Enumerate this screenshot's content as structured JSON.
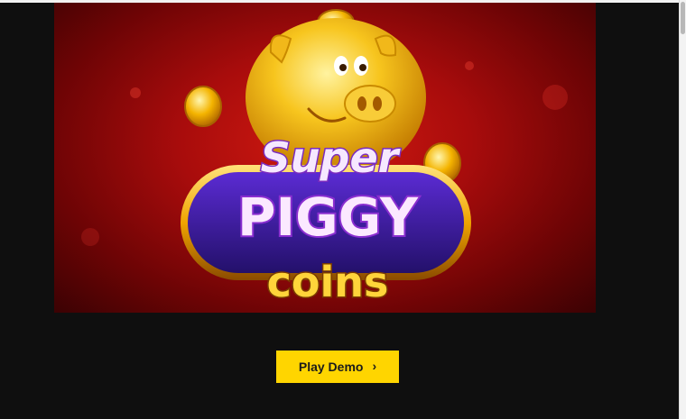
{
  "banner": {
    "logo": {
      "line1": "Super",
      "line2": "PIGGY",
      "line3": "coins"
    }
  },
  "cta": {
    "label": "Play Demo",
    "icon": "chevron-right-icon",
    "color": "#ffd500"
  },
  "colors": {
    "page_bg": "#0f0f0f",
    "banner_red": "#c8140f",
    "badge_purple": "#3a1a8c",
    "gold": "#f6b400"
  }
}
